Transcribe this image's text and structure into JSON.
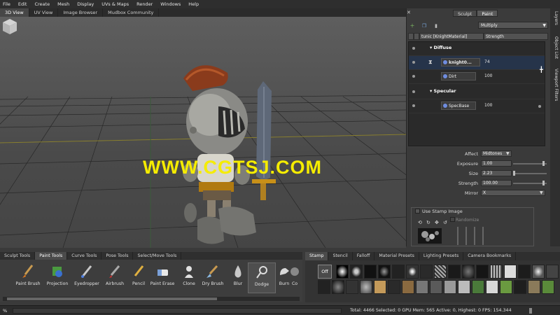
{
  "menu": [
    "File",
    "Edit",
    "Create",
    "Mesh",
    "Display",
    "UVs & Maps",
    "Render",
    "Windows",
    "Help"
  ],
  "view_tabs": [
    {
      "label": "3D View",
      "active": true
    },
    {
      "label": "UV View",
      "active": false
    },
    {
      "label": "Image Browser",
      "active": false
    },
    {
      "label": "Mudbox Community",
      "active": false
    }
  ],
  "viewport": {
    "watermark": "WWW.CGTSJ.COM",
    "watermark_color": "#f5ec00",
    "viewcube_icon": "viewcube-icon"
  },
  "side_tabs": [
    "Layers",
    "Object List",
    "Viewport Filters"
  ],
  "layers_panel": {
    "tabs": [
      {
        "label": "Sculpt",
        "active": false
      },
      {
        "label": "Paint",
        "active": true
      }
    ],
    "blend_mode": "Multiply",
    "header": {
      "material": "tunic [KnightMaterial]",
      "column": "Strength"
    },
    "groups": [
      {
        "name": "Diffuse",
        "layers": [
          {
            "name": "knight0...",
            "value": "74",
            "selected": true
          },
          {
            "name": "Dirt",
            "value": "100",
            "selected": false
          }
        ]
      },
      {
        "name": "Specular",
        "layers": [
          {
            "name": "SpecBase",
            "value": "100",
            "selected": false
          }
        ]
      }
    ]
  },
  "properties": {
    "affect_label": "Affect",
    "affect_value": "Midtones",
    "exposure_label": "Exposure",
    "exposure_value": "1.00",
    "size_label": "Size",
    "size_value": "2.23",
    "strength_label": "Strength",
    "strength_value": "100.00",
    "mirror_label": "Mirror",
    "mirror_value": "X",
    "use_stamp_label": "Use Stamp Image",
    "randomize_label": "Randomize"
  },
  "tool_tabs": [
    {
      "label": "Sculpt Tools",
      "active": false
    },
    {
      "label": "Paint Tools",
      "active": true
    },
    {
      "label": "Curve Tools",
      "active": false
    },
    {
      "label": "Pose Tools",
      "active": false
    },
    {
      "label": "Select/Move Tools",
      "active": false
    }
  ],
  "tools": [
    {
      "label": "Paint Brush",
      "icon": "paint-brush-icon"
    },
    {
      "label": "Projection",
      "icon": "projection-icon"
    },
    {
      "label": "Eyedropper",
      "icon": "eyedropper-icon"
    },
    {
      "label": "Airbrush",
      "icon": "airbrush-icon"
    },
    {
      "label": "Pencil",
      "icon": "pencil-icon"
    },
    {
      "label": "Paint Erase",
      "icon": "eraser-icon"
    },
    {
      "label": "Clone",
      "icon": "clone-icon"
    },
    {
      "label": "Dry Brush",
      "icon": "dry-brush-icon"
    },
    {
      "label": "Blur",
      "icon": "blur-icon"
    },
    {
      "label": "Dodge",
      "icon": "dodge-icon",
      "active": true
    },
    {
      "label": "Burn",
      "icon": "burn-icon"
    },
    {
      "label": "Co",
      "icon": "contrast-icon"
    }
  ],
  "stamp_tabs": [
    {
      "label": "Stamp",
      "active": true
    },
    {
      "label": "Stencil",
      "active": false
    },
    {
      "label": "Falloff",
      "active": false
    },
    {
      "label": "Material Presets",
      "active": false
    },
    {
      "label": "Lighting Presets",
      "active": false
    },
    {
      "label": "Camera Bookmarks",
      "active": false
    }
  ],
  "stamps": {
    "off_label": "Off"
  },
  "status": {
    "percent": "%",
    "stats": "Total: 4466  Selected: 0 GPU Mem: 565  Active: 0, Highest: 0  FPS: 154.344"
  }
}
